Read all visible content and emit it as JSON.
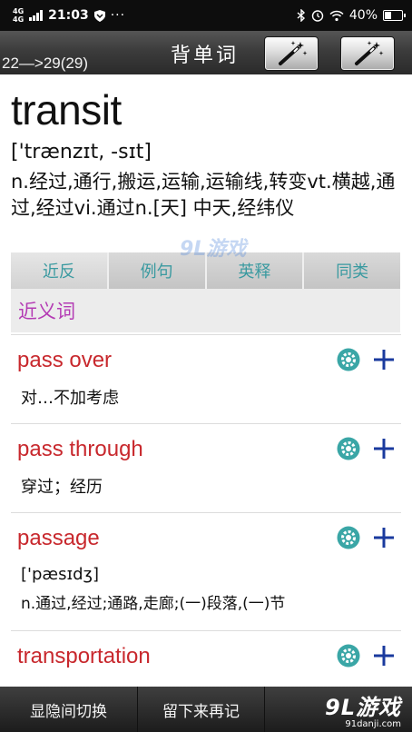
{
  "status_bar": {
    "network": [
      "4G",
      "4G"
    ],
    "time": "21:03",
    "dots": "···",
    "battery_pct": "40%",
    "battery_level": 0.4
  },
  "header": {
    "progress": "22—>29(29)",
    "title": "背单词"
  },
  "word": {
    "headword": "transit",
    "phonetic": "['trænzɪt, -sɪt]",
    "definition": "n.经过,通行,搬运,运输,运输线,转变vt.横越,通过,经过vi.通过n.[天] 中天,经纬仪"
  },
  "tabs": [
    {
      "label": "近反"
    },
    {
      "label": "例句"
    },
    {
      "label": "英释"
    },
    {
      "label": "同类"
    }
  ],
  "section": {
    "title": "近义词"
  },
  "entries": [
    {
      "word": "pass over",
      "phonetic": "",
      "meaning": "对…不加考虑"
    },
    {
      "word": "pass through",
      "phonetic": "",
      "meaning": "穿过；经历"
    },
    {
      "word": "passage",
      "phonetic": "['pæsɪdʒ]",
      "meaning": "n.通过,经过;通路,走廊;(一)段落,(一)节"
    },
    {
      "word": "transportation",
      "phonetic": "",
      "meaning": ""
    }
  ],
  "bottom_bar": {
    "toggle_label": "显隐间切换",
    "later_label": "留下来再记"
  },
  "watermark": {
    "main": "9L游戏",
    "sub": "91danji.com"
  },
  "colors": {
    "accent_teal": "#3a9aa0",
    "word_red": "#c8282d",
    "section_purple": "#b43bb4",
    "plus_blue": "#1a3a9e"
  }
}
